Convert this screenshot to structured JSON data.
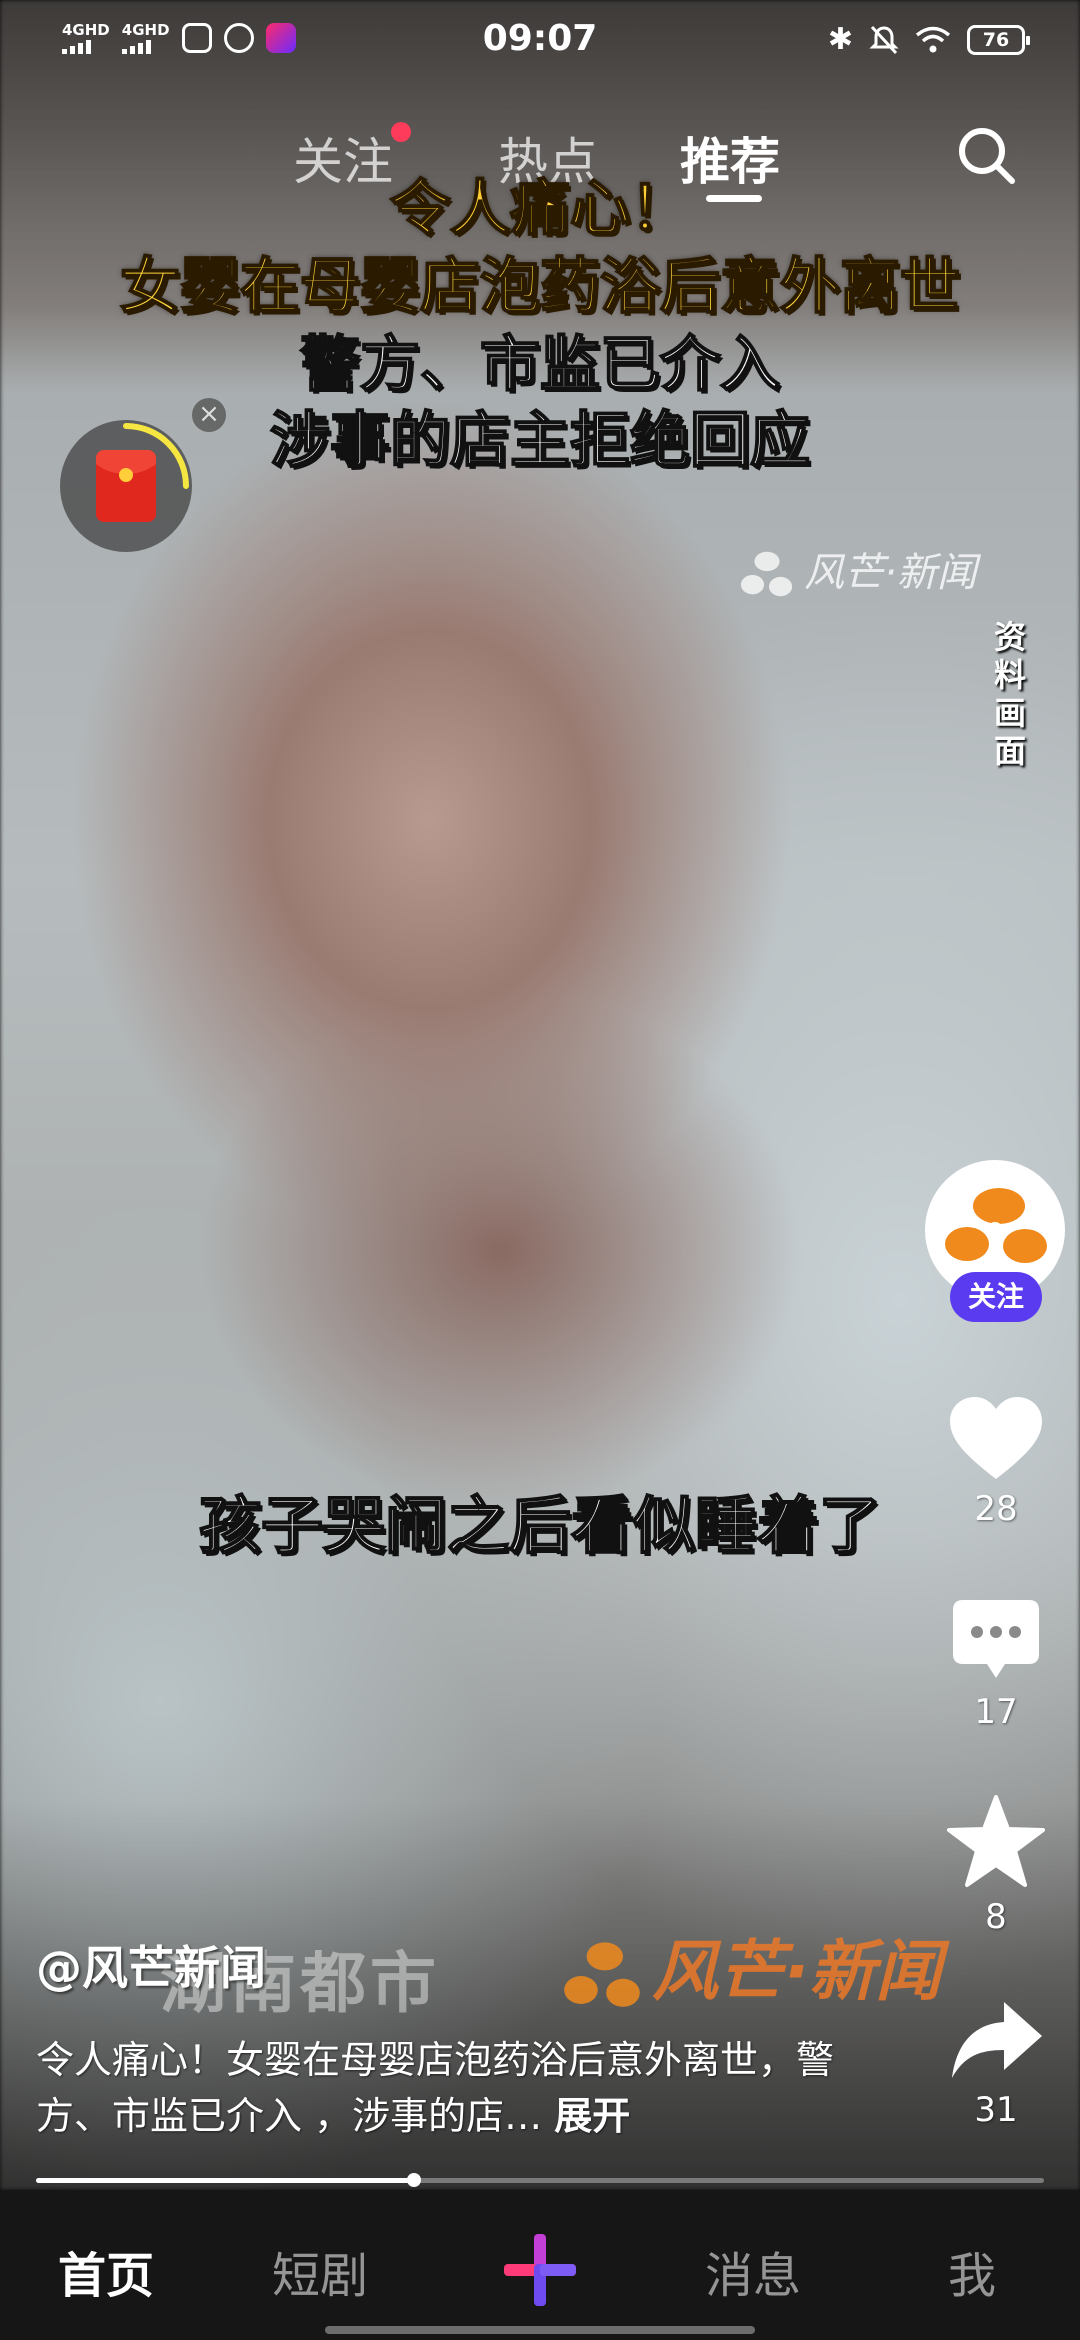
{
  "status_bar": {
    "sim1": "4GHD",
    "sim2": "4GHD",
    "time": "09:07",
    "battery": "76"
  },
  "top_nav": {
    "tabs": [
      {
        "label": "关注",
        "has_dot": true
      },
      {
        "label": "热点"
      },
      {
        "label": "推荐",
        "active": true
      }
    ]
  },
  "video": {
    "headline_lines": [
      "令人痛心！",
      "女婴在母婴店泡药浴后意外离世",
      "警方、市监已介入",
      "涉事的店主拒绝回应"
    ],
    "watermark_top": "风芒·新闻",
    "side_caption": "资料画面",
    "subtitle": "孩子哭闹之后看似睡着了",
    "watermark_bottom_left": "湖南都市",
    "watermark_bottom_right": "风芒·新闻"
  },
  "actions": {
    "follow_label": "关注",
    "likes": "28",
    "comments": "17",
    "favorites": "8",
    "shares": "31"
  },
  "caption": {
    "author": "@风芒新闻",
    "text": "令人痛心！女婴在母婴店泡药浴后意外离世，警方、市监已介入 ，涉事的店…",
    "expand": "展开"
  },
  "playback": {
    "progress": 0.375
  },
  "bottom_nav": {
    "items": [
      "首页",
      "短剧",
      "消息",
      "我"
    ]
  },
  "colors": {
    "follow_accent": "#5b3bf0",
    "notification_dot": "#ff3b5c",
    "headline_yellow": "#ffcf33",
    "brand_orange": "#f08a1c"
  }
}
